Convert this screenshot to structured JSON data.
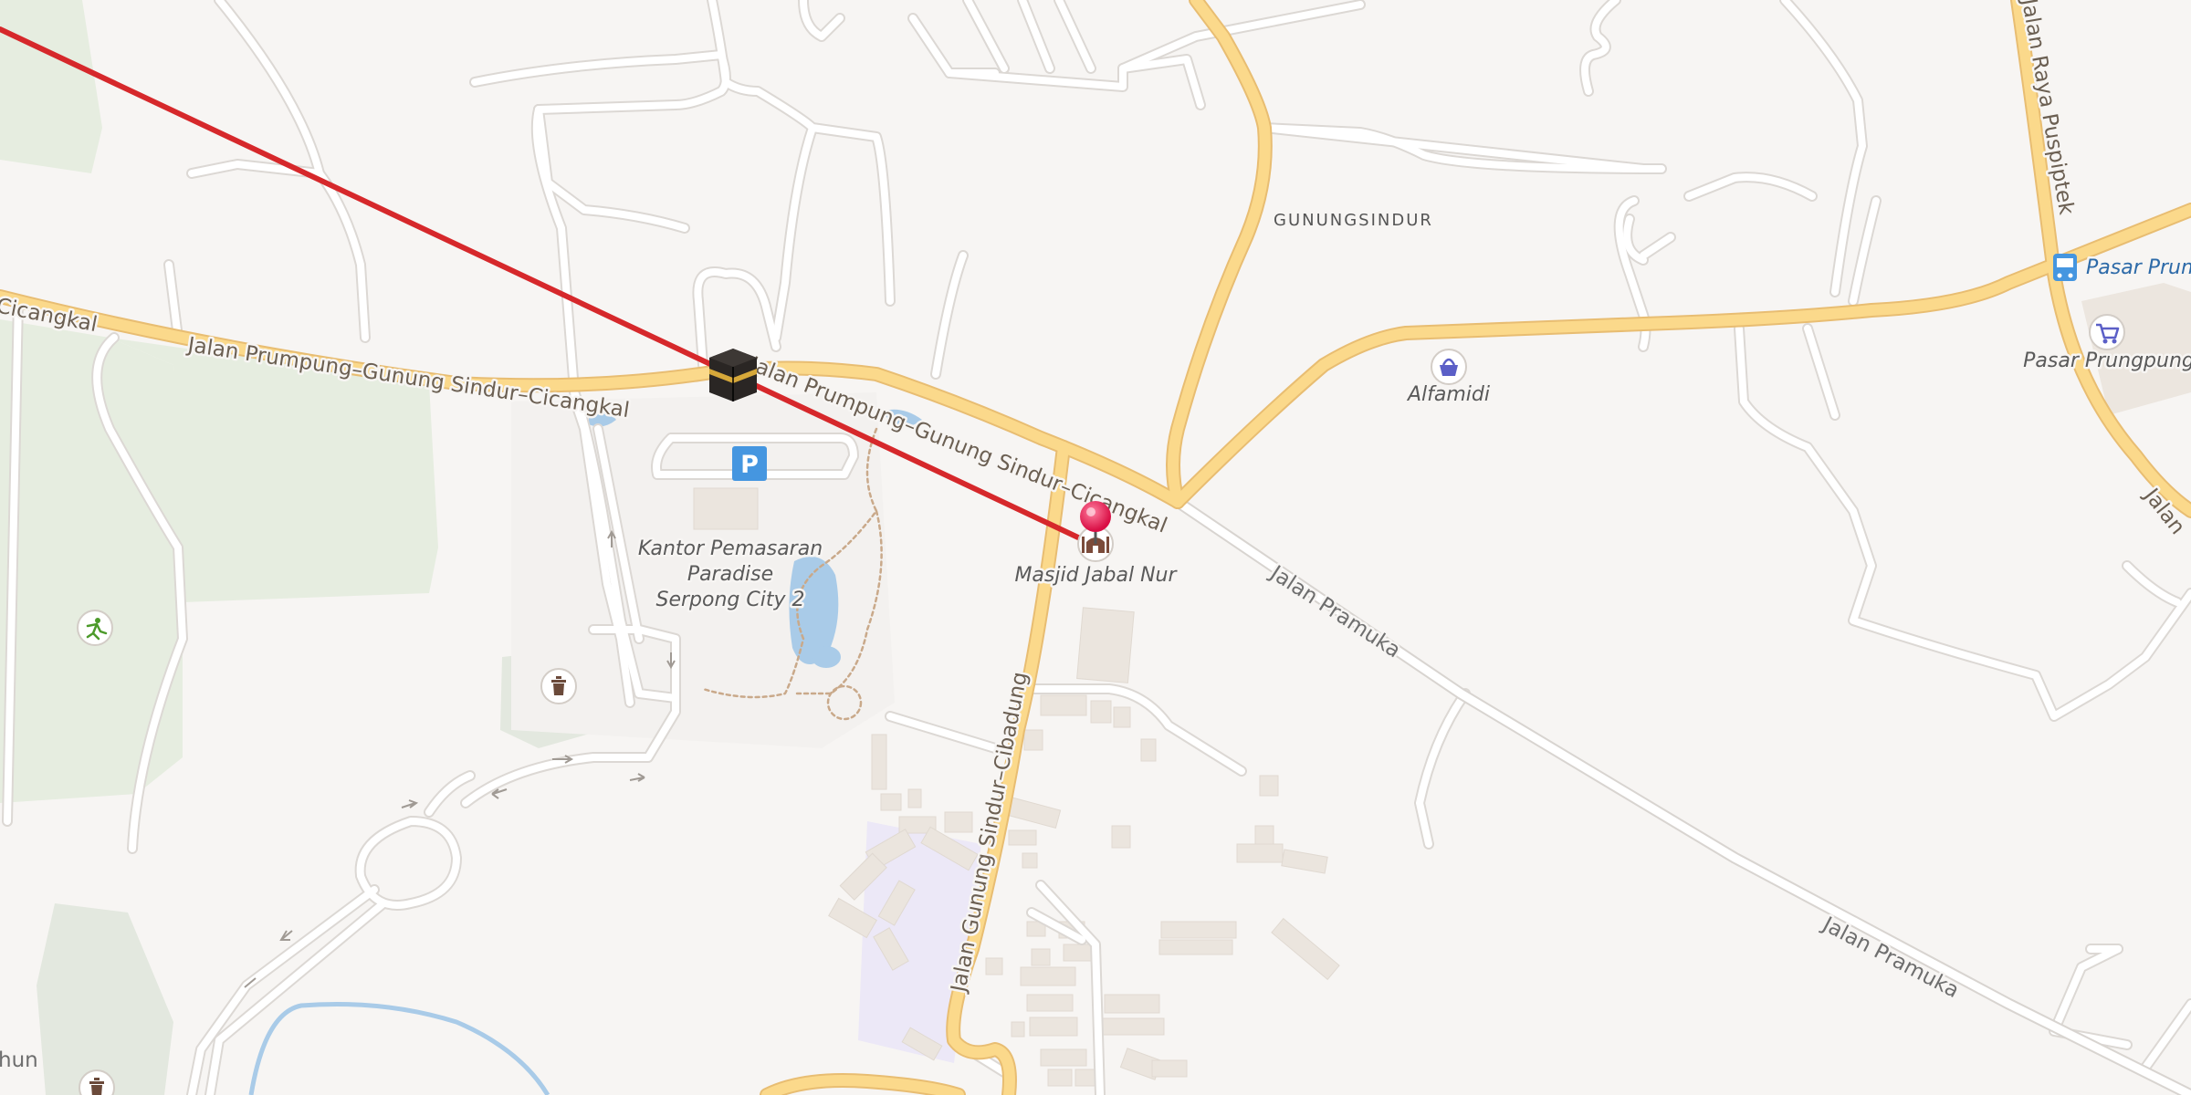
{
  "map": {
    "labels": {
      "road_main_1": "Jalan Prumpung–Gunung Sindur–Cicangkal",
      "road_main_2": "Jalan Prumpung–Gunung Sindur–Cicangkal",
      "road_main_left": "Cicangkal",
      "road_pramuka_1": "Jalan Pramuka",
      "road_pramuka_2": "Jalan Pramuka",
      "road_cibadung": "Jalan Gunung Sindur–Cibadung",
      "road_puspiptek": "Jalan Raya Puspiptek",
      "road_edge_right": "Jalan",
      "road_edge_left": "hun",
      "place_gunungsindur": "GUNUNGSINDUR",
      "poi_masjid": "Masjid Jabal Nur",
      "poi_kantor_line1": "Kantor Pemasaran",
      "poi_kantor_line2": "Paradise",
      "poi_kantor_line3": "Serpong City 2",
      "poi_alfamidi": "Alfamidi",
      "poi_pasar_bus": "Pasar Prum",
      "poi_pasar_market": "Pasar Prungpung"
    },
    "icons": {
      "kaaba": "kaaba-icon",
      "parking": "parking-icon",
      "pin": "location-pin-icon",
      "mosque": "mosque-icon",
      "shop": "shopping-basket-icon",
      "market": "shopping-cart-icon",
      "bus": "bus-stop-icon",
      "sport": "sports-icon",
      "trash": "waste-basket-icon"
    },
    "colors": {
      "background": "#f7f5f3",
      "major_road": "#fbd98b",
      "major_road_casing": "#e8bd72",
      "minor_road": "#ffffff",
      "minor_road_casing": "#dcd8d4",
      "qibla_line": "#d6282b",
      "park": "#e6ede0",
      "water": "#a9cbe8",
      "building": "#ece6df",
      "pin": "#e8194e",
      "parking": "#4596e0",
      "poi_blue": "#5b5fc7"
    }
  }
}
